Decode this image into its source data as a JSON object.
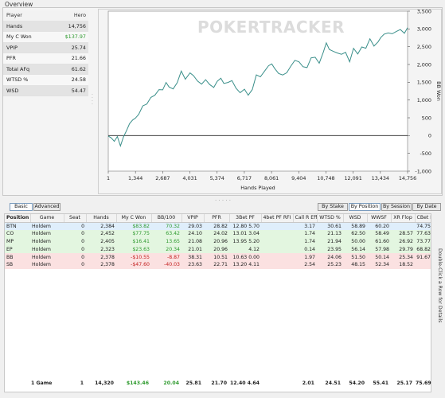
{
  "overview": {
    "title": "Overview",
    "stats_header": {
      "label": "Player",
      "value": "Hero"
    },
    "stats": [
      {
        "label": "Hands",
        "value": "14,756",
        "color": "normal"
      },
      {
        "label": "My C Won",
        "value": "$137.97",
        "color": "green"
      },
      {
        "label": "VPIP",
        "value": "25.74",
        "color": "normal"
      },
      {
        "label": "PFR",
        "value": "21.66",
        "color": "normal"
      },
      {
        "label": "Total AFq",
        "value": "61.62",
        "color": "normal"
      },
      {
        "label": "WTSD %",
        "value": "24.58",
        "color": "normal"
      },
      {
        "label": "WSD",
        "value": "54.47",
        "color": "normal"
      }
    ]
  },
  "chart_watermark": "POKERTRACKER",
  "chart_data": {
    "type": "line",
    "xlabel": "Hands Played",
    "ylabel": "BB Won",
    "xlim": [
      1,
      14756
    ],
    "ylim": [
      -1000,
      3500
    ],
    "x_ticks": [
      "1",
      "1,344",
      "2,687",
      "4,031",
      "5,374",
      "6,717",
      "8,061",
      "9,404",
      "10,748",
      "12,091",
      "13,434",
      "14,756"
    ],
    "y_ticks": [
      "-1,000",
      "-500",
      "0",
      "500",
      "1,000",
      "1,500",
      "2,000",
      "2,500",
      "3,000",
      "3,500"
    ],
    "line_color": "#3a8f8a",
    "series": [
      {
        "x": [
          1,
          150,
          300,
          450,
          600,
          750,
          900,
          1050,
          1200,
          1344,
          1500,
          1700,
          1900,
          2100,
          2300,
          2500,
          2687,
          2850,
          3000,
          3200,
          3400,
          3600,
          3800,
          4031,
          4200,
          4400,
          4600,
          4800,
          5000,
          5200,
          5374,
          5550,
          5700,
          5900,
          6100,
          6300,
          6500,
          6717,
          6900,
          7100,
          7300,
          7500,
          7700,
          7900,
          8061,
          8200,
          8400,
          8600,
          8800,
          9000,
          9200,
          9404,
          9600,
          9800,
          10000,
          10200,
          10400,
          10600,
          10748,
          10900,
          11100,
          11300,
          11500,
          11700,
          11900,
          12091,
          12300,
          12500,
          12700,
          12900,
          13100,
          13300,
          13434,
          13600,
          13800,
          14000,
          14200,
          14400,
          14600,
          14756
        ],
        "y": [
          0,
          -80,
          -150,
          -40,
          -280,
          -50,
          150,
          320,
          450,
          480,
          610,
          820,
          900,
          1060,
          1150,
          1280,
          1300,
          1480,
          1380,
          1300,
          1500,
          1800,
          1600,
          1750,
          1700,
          1520,
          1460,
          1560,
          1450,
          1340,
          1540,
          1600,
          1480,
          1480,
          1560,
          1320,
          1220,
          1290,
          1150,
          1280,
          1720,
          1640,
          1820,
          1950,
          2030,
          1880,
          1760,
          1690,
          1780,
          1940,
          2130,
          2060,
          1950,
          1900,
          2200,
          2190,
          2050,
          2330,
          2620,
          2410,
          2380,
          2310,
          2300,
          2330,
          2090,
          2440,
          2310,
          2480,
          2470,
          2710,
          2530,
          2620,
          2770,
          2840,
          2900,
          2850,
          2940,
          2970,
          2890,
          3020
        ]
      }
    ]
  },
  "toolbar": {
    "basic": "Basic",
    "advanced": "Advanced",
    "by_stake": "By Stake",
    "by_position": "By Position",
    "by_session": "By Session",
    "by_date": "By Date"
  },
  "table": {
    "columns": [
      "Position",
      "Game",
      "Seat",
      "Hands",
      "My C Won",
      "BB/100",
      "VPIP",
      "PFR",
      "3Bet PF",
      "4bet PF RFI",
      "Call R Eff",
      "WTSD %",
      "WSD",
      "WWSF",
      "XR Flop",
      "CBet F IP"
    ],
    "rows": [
      {
        "cells": [
          "BTN",
          "Holdem",
          "0",
          "2,384",
          "$83.82",
          "70.32",
          "29.03",
          "28.82",
          "12.80 5.70",
          "",
          "3.17",
          "30.61",
          "58.89",
          "60.20",
          "",
          "74.75"
        ],
        "tone": "blue"
      },
      {
        "cells": [
          "CO",
          "Holdem",
          "0",
          "2,452",
          "$77.75",
          "63.42",
          "24.10",
          "24.02",
          "13.01 3.04",
          "",
          "1.74",
          "21.13",
          "62.50",
          "58.49",
          "28.57",
          "77.63"
        ],
        "tone": "green"
      },
      {
        "cells": [
          "MP",
          "Holdem",
          "0",
          "2,405",
          "$16.41",
          "13.65",
          "21.08",
          "20.96",
          "13.95 5.20",
          "",
          "1.74",
          "21.94",
          "50.00",
          "61.60",
          "26.92",
          "73.77"
        ],
        "tone": "green"
      },
      {
        "cells": [
          "EP",
          "Holdem",
          "0",
          "2,323",
          "$23.63",
          "20.34",
          "21.01",
          "20.96",
          "4.12",
          "",
          "0.14",
          "23.95",
          "56.14",
          "57.98",
          "29.79",
          "68.82"
        ],
        "tone": "green"
      },
      {
        "cells": [
          "BB",
          "Holdem",
          "0",
          "2,378",
          "-$10.55",
          "-8.87",
          "38.31",
          "10.51",
          "10.63 0.00",
          "",
          "1.97",
          "24.06",
          "51.50",
          "50.14",
          "25.34",
          "91.67"
        ],
        "tone": "red"
      },
      {
        "cells": [
          "SB",
          "Holdem",
          "0",
          "2,378",
          "-$47.60",
          "-40.03",
          "23.63",
          "22.71",
          "13.20 4.11",
          "",
          "2.54",
          "25.23",
          "48.15",
          "52.34",
          "18.52",
          ""
        ],
        "tone": "red"
      }
    ],
    "totals": [
      "",
      "1 Game",
      "1",
      "14,320",
      "$143.46",
      "20.04",
      "25.81",
      "21.70",
      "12.40 4.64",
      "",
      "2.01",
      "24.51",
      "54.20",
      "55.41",
      "25.17",
      "75.69"
    ]
  },
  "side_hint": "Double-Click a Row for Details"
}
